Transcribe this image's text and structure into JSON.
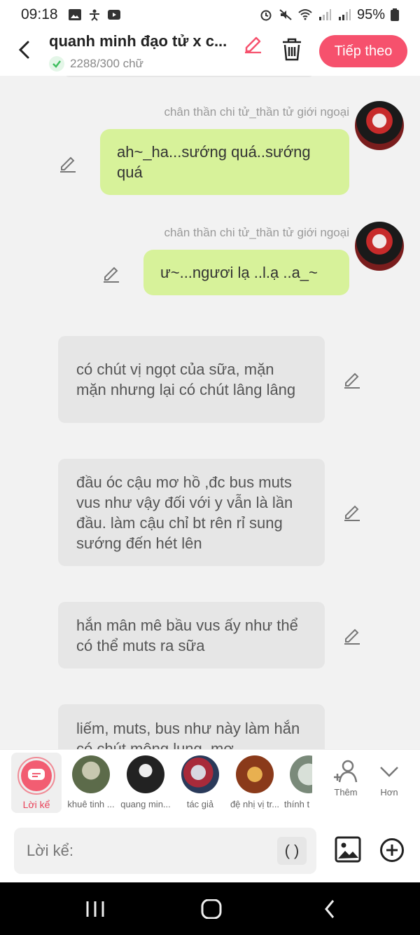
{
  "status": {
    "time": "09:18",
    "battery": "95%"
  },
  "header": {
    "title": "quanh minh đạo tử x c...",
    "word_count": "2288/300 chữ",
    "next_label": "Tiếp theo"
  },
  "messages": [
    {
      "type": "char",
      "name": "chân thần chi tử_thần tử giới ngoại",
      "text": "ah~_ha...sướng quá..sướng quá"
    },
    {
      "type": "char",
      "name": "chân thần chi tử_thần tử giới ngoại",
      "text": "ư~...ngươi lạ ..l.ạ ..a_~"
    },
    {
      "type": "narr",
      "text": "có chút vị ngọt của sữa, mặn mặn nhưng lại có chút lâng lâng"
    },
    {
      "type": "narr",
      "text": "đầu óc cậu mơ hồ ,đc bus muts vus như vậy đối với y vẫn là lần đầu. làm cậu chỉ bt rên rỉ sung sướng đến hét lên"
    },
    {
      "type": "narr",
      "text": "hắn mân mê bầu vus ấy như thể có thể muts ra sữa"
    },
    {
      "type": "narr",
      "text": "liếm, muts, bus như này làm hắn có chút mông lung, mơ"
    }
  ],
  "characters": {
    "narrator_label": "Lời kể",
    "list": [
      "khuê tinh ...",
      "quang min...",
      "tác giả",
      "đệ nhị vị tr...",
      "thính t"
    ],
    "more_label": "Thêm",
    "collapse_label": "Hơn"
  },
  "input": {
    "placeholder": "Lời kể:",
    "paren_label": "( )"
  },
  "colors": {
    "accent": "#f6516d",
    "char_bubble": "#d7f29a",
    "narr_bubble": "#e6e6e6"
  }
}
